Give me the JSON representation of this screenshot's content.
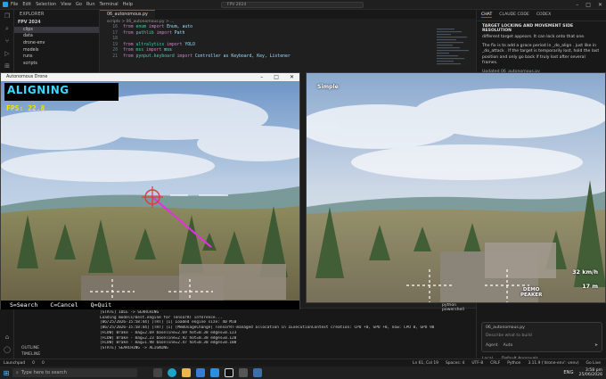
{
  "titlebar": {
    "menus": [
      "File",
      "Edit",
      "Selection",
      "View",
      "Go",
      "Run",
      "Terminal",
      "Help"
    ],
    "search": "FPV 2024"
  },
  "sidebar": {
    "header": "EXPLORER",
    "root": "FPV 2024",
    "items": [
      "clips",
      "data",
      "drone-env",
      "models",
      "runs",
      "scripts"
    ]
  },
  "editor": {
    "tab": "06_autonomous.py",
    "breadcrumb": "scripts > 06_autonomous.py > ...",
    "lines": [
      {
        "n": "16",
        "kw": "from",
        "mod": "enum",
        "kw2": "import",
        "rest": "Enum, auto"
      },
      {
        "n": "17",
        "kw": "from",
        "mod": "pathlib",
        "kw2": "import",
        "rest": "Path"
      },
      {
        "n": "18",
        "kw": "",
        "mod": "",
        "kw2": "",
        "rest": ""
      },
      {
        "n": "19",
        "kw": "from",
        "mod": "ultralytics",
        "kw2": "import",
        "rest": "YOLO"
      },
      {
        "n": "20",
        "kw": "from",
        "mod": "mss",
        "kw2": "import",
        "rest": "mss"
      },
      {
        "n": "21",
        "kw": "from",
        "mod": "pynput.keyboard",
        "kw2": "import",
        "rest": "Controller as Keyboard, Key, Listener"
      }
    ]
  },
  "chat": {
    "tabs": [
      "CHAT",
      "CLAUDE CODE",
      "CODEX"
    ],
    "heading": "TARGET LOCKING AND MOVEMENT SIDE RESOLUTION",
    "p1": "different target appears. It can lock onto that one.",
    "p2": "The fix is to add a grace period in _do_align . just like in _do_attack . If the target is temporarily lost, hold the last position and only go back if truly lost after several frames.",
    "p3": "Updated 06_autonomous.py",
    "file_chip": "06_autonomous.py",
    "input_placeholder": "Describe what to build",
    "agent": "Agent",
    "model": "Auto",
    "local": "Local",
    "approvals": "Default Approvals"
  },
  "terminal": {
    "lines": [
      "[STATE] IDLE -> SEARCHING",
      "Loading models/best.engine for TensorRT inference...",
      "[06/25/2026-15:58:44] [TRT] [I] Loaded engine size: 40 MiB",
      "[06/25/2026-15:58:44] [TRT] [I] [MemUsageChange] TensorRT-managed allocation in IExecutionContext creation: CPU +0, GPU +8, now: CPU 0, GPU 90 (MiB)",
      "[FLOW] Brake - mag=2.69 baseline=2.69 hot=0.38 edges=0.123",
      "[FLOW] Brake - mag=2.23 baseline=2.92 hot=0.38 edges=0.120",
      "[FLOW] Brake - mag=1.98 baseline=2.47 hot=0.38 edges=0.108",
      "[STATE] SEARCHING -> ALIGNING"
    ],
    "shells": [
      "python",
      "powershell"
    ]
  },
  "outline": [
    "OUTLINE",
    "TIMELINE"
  ],
  "statusbar": {
    "left": [
      "Launchpad",
      "0",
      "0"
    ],
    "right": [
      "Ln 61, Col 19",
      "Spaces: 4",
      "UTF-8",
      "CRLF",
      "Python",
      "3.11.9 ('drone-env': venv)",
      "Go Live"
    ]
  },
  "taskbar": {
    "search": "Type here to search",
    "lang": "ENG",
    "time": "3:58 pm",
    "date": "25/06/2026"
  },
  "game": {
    "window_title": "Autonomous Drone",
    "status": "ALIGNING",
    "fps_label": "FPS:",
    "fps_value": "22.8",
    "hint_search": "S=Search",
    "hint_cancel": "C=Cancel",
    "hint_quit": "Q=Quit"
  },
  "simple": {
    "label": "Simple",
    "speed": "32 km/h",
    "distance": "17 m",
    "demo_line1": "DEMO",
    "demo_line2": "PEAKER"
  },
  "colors": {
    "accent": "#0078d4",
    "status_text": "#3fd7ff",
    "fps_text": "#f2e600",
    "tracking_line": "#e62ee6",
    "crosshair": "#e23b3b"
  }
}
